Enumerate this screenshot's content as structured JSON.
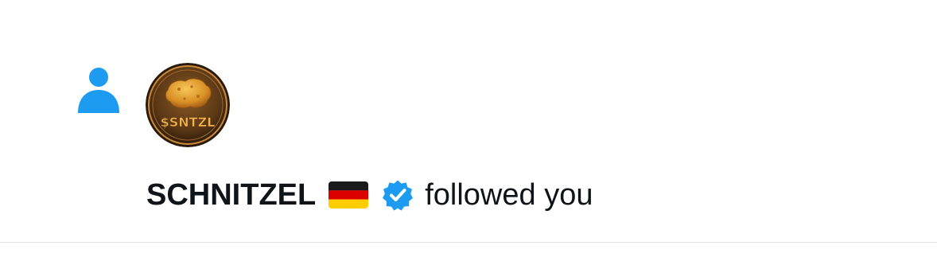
{
  "notification": {
    "type_icon": "person-follow-icon",
    "avatar": {
      "icon": "nugget-coin-avatar",
      "label": "$SNTZL"
    },
    "user": {
      "display_name": "SCHNITZEL",
      "flag_icon": "germany-flag-icon",
      "verified_icon": "verified-badge-icon"
    },
    "action_text": "followed you"
  },
  "colors": {
    "accent": "#1d9bf0",
    "text": "#0f1419",
    "divider": "#dfe3e6",
    "coin_dark": "#3b2410",
    "coin_mid": "#7a4a1e",
    "coin_gold": "#e8a93a"
  }
}
